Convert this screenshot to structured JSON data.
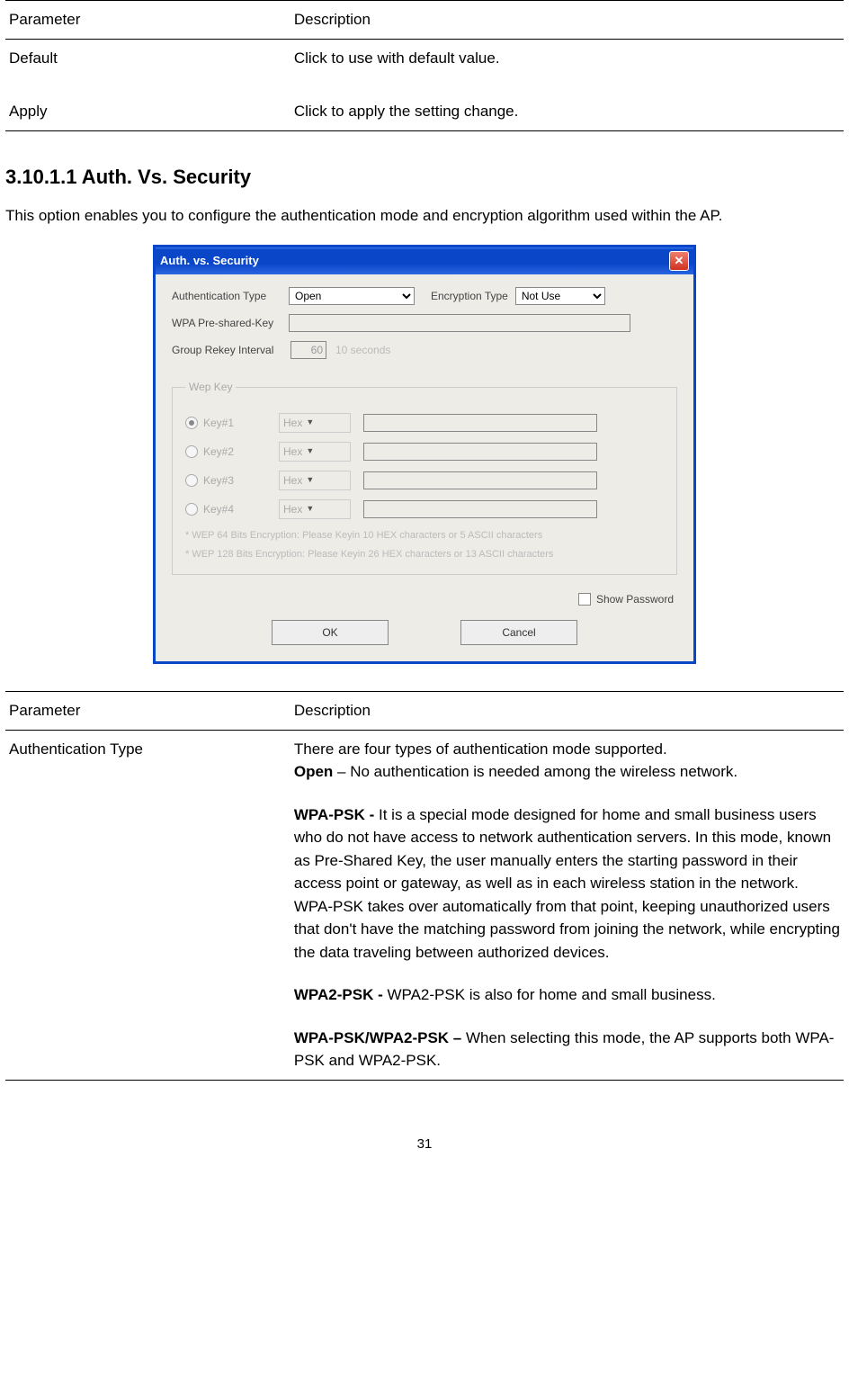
{
  "table1": {
    "headers": {
      "param": "Parameter",
      "desc": "Description"
    },
    "rows": [
      {
        "param": "Default",
        "desc": "Click to use with default value."
      },
      {
        "param": "Apply",
        "desc": "Click to apply the setting change."
      }
    ]
  },
  "section": {
    "heading": "3.10.1.1 Auth. Vs. Security",
    "intro": "This option enables you to configure the authentication mode and encryption algorithm used within the AP."
  },
  "dialog": {
    "title": "Auth. vs. Security",
    "labels": {
      "authType": "Authentication Type",
      "encType": "Encryption Type",
      "wpaPsk": "WPA Pre-shared-Key",
      "groupRekey": "Group Rekey Interval",
      "tenSeconds": "10 seconds",
      "wepLegend": "Wep Key",
      "key1": "Key#1",
      "key2": "Key#2",
      "key3": "Key#3",
      "key4": "Key#4",
      "hex": "Hex",
      "hint1": "* WEP 64 Bits Encryption:  Please Keyin 10 HEX characters or 5 ASCII characters",
      "hint2": "* WEP 128 Bits Encryption:  Please Keyin 26 HEX characters or 13 ASCII characters",
      "showPassword": "Show Password",
      "ok": "OK",
      "cancel": "Cancel"
    },
    "values": {
      "authType": "Open",
      "encType": "Not Use",
      "groupRekey": "60"
    }
  },
  "table2": {
    "headers": {
      "param": "Parameter",
      "desc": "Description"
    },
    "row": {
      "param": "Authentication Type",
      "desc": {
        "line1": "There are four types of authentication mode supported.",
        "open_b": "Open",
        "open_rest": " – No authentication is needed among the wireless network.",
        "wpapsk_b": "WPA-PSK - ",
        "wpapsk_rest": "It is a special mode designed for home and small business users who do not have access to network authentication servers. In this mode, known as Pre-Shared Key, the user manually enters the starting password in their access point or gateway, as well as in each wireless station in the network. WPA-PSK takes over automatically from that point, keeping unauthorized users that don't have the matching password from joining the network, while encrypting the data traveling between authorized devices.",
        "wpa2psk_b": "WPA2-PSK - ",
        "wpa2psk_rest": "WPA2-PSK is also for home and small business.",
        "both_b": "WPA-PSK/WPA2-PSK – ",
        "both_rest": "When selecting this mode, the AP supports both WPA-PSK and WPA2-PSK."
      }
    }
  },
  "pageNumber": "31"
}
